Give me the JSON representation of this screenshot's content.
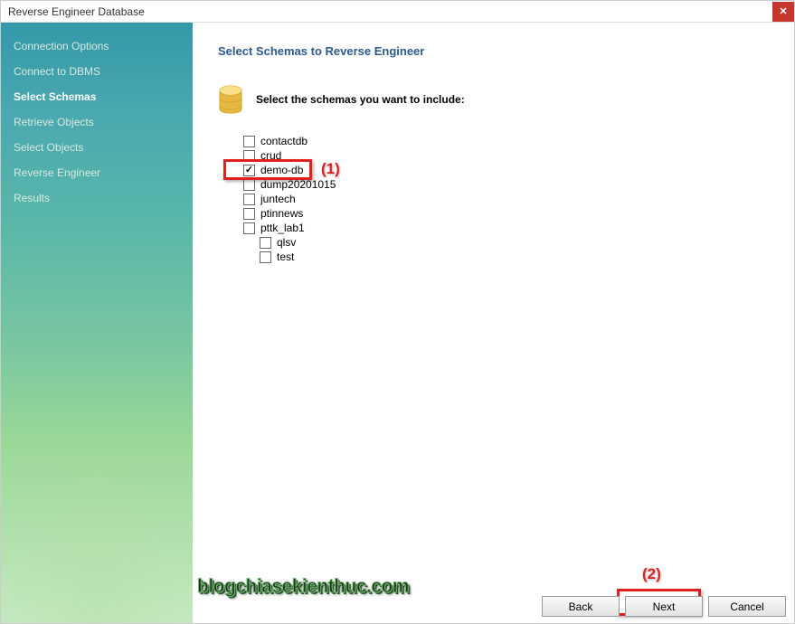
{
  "window": {
    "title": "Reverse Engineer Database"
  },
  "sidebar": {
    "items": [
      {
        "label": "Connection Options",
        "active": false
      },
      {
        "label": "Connect to DBMS",
        "active": false
      },
      {
        "label": "Select Schemas",
        "active": true
      },
      {
        "label": "Retrieve Objects",
        "active": false
      },
      {
        "label": "Select Objects",
        "active": false
      },
      {
        "label": "Reverse Engineer",
        "active": false
      },
      {
        "label": "Results",
        "active": false
      }
    ]
  },
  "main": {
    "title": "Select Schemas to Reverse Engineer",
    "instruction": "Select the schemas you want to include:",
    "schemas": [
      {
        "label": "contactdb",
        "checked": false,
        "indent": false
      },
      {
        "label": "crud",
        "checked": false,
        "indent": false
      },
      {
        "label": "demo-db",
        "checked": true,
        "indent": false
      },
      {
        "label": "dump20201015",
        "checked": false,
        "indent": false
      },
      {
        "label": "juntech",
        "checked": false,
        "indent": false
      },
      {
        "label": "ptinnews",
        "checked": false,
        "indent": false
      },
      {
        "label": "pttk_lab1",
        "checked": false,
        "indent": false
      },
      {
        "label": "qlsv",
        "checked": false,
        "indent": true
      },
      {
        "label": "test",
        "checked": false,
        "indent": true
      }
    ]
  },
  "footer": {
    "back": "Back",
    "next": "Next",
    "cancel": "Cancel"
  },
  "annotations": {
    "one": "(1)",
    "two": "(2)"
  },
  "watermark": "blogchiasekienthuc.com"
}
